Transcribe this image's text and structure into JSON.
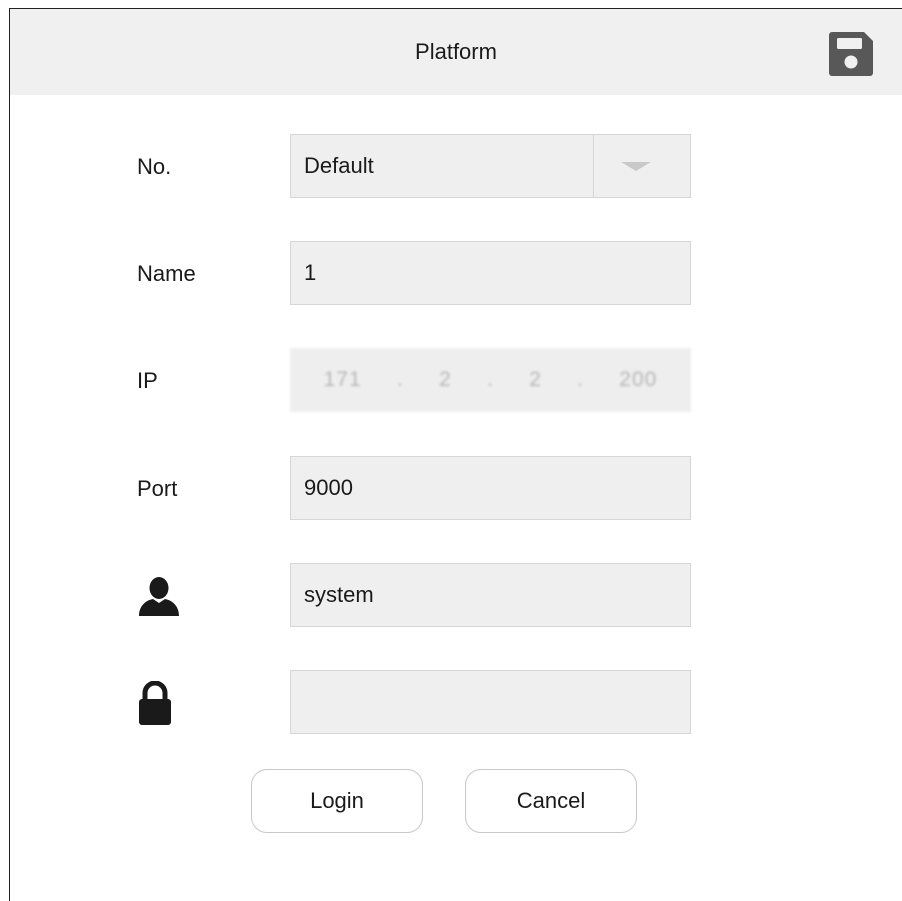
{
  "header": {
    "title": "Platform",
    "save_icon": "save-icon"
  },
  "form": {
    "no": {
      "label": "No.",
      "value": "Default"
    },
    "name": {
      "label": "Name",
      "value": "1"
    },
    "ip": {
      "label": "IP",
      "octets": [
        "171",
        "2",
        "2",
        "200"
      ],
      "separator": "."
    },
    "port": {
      "label": "Port",
      "value": "9000"
    },
    "username": {
      "icon": "user-icon",
      "value": "system"
    },
    "password": {
      "icon": "lock-icon",
      "value": ""
    }
  },
  "buttons": {
    "login": "Login",
    "cancel": "Cancel"
  },
  "colors": {
    "header_bg": "#f0f0f0",
    "field_bg": "#efefef",
    "field_border": "#d6d6d6",
    "icon": "#555555"
  }
}
